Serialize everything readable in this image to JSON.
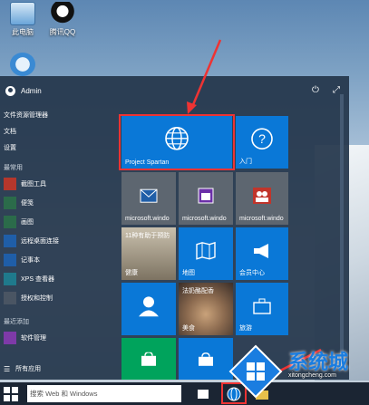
{
  "desktop": {
    "icons": [
      {
        "label": "此电脑"
      },
      {
        "label": "腾讯QQ"
      }
    ]
  },
  "start_menu": {
    "user": "Admin",
    "links": [
      "文件资源管理器",
      "文档",
      "设置"
    ],
    "section_frequent": "最常用",
    "apps": [
      "截图工具",
      "便笺",
      "画图",
      "远程桌面连接",
      "记事本",
      "XPS 查看器",
      "授权和控制"
    ],
    "section_recent": "最近添加",
    "recent_apps": [
      "软件管理"
    ],
    "all_apps": "所有应用"
  },
  "tiles": {
    "spartan": "Project Spartan",
    "getstarted": "入门",
    "mail": "microsoft.windo",
    "calendar": "microsoft.windo",
    "people": "microsoft.windo",
    "health_top": "11种有助于预防",
    "health_bottom": "健康",
    "maps": "地图",
    "contact": "会员中心",
    "user_tile": "",
    "food_top": "法奶酪配香",
    "food_bottom": "美食",
    "travel": "旅游"
  },
  "taskbar": {
    "search_placeholder": "搜索 Web 和 Windows"
  },
  "watermark": {
    "brand": "系统城",
    "url": "xitongcheng.com"
  },
  "colors": {
    "tile_blue": "#0a78d7",
    "tile_gray": "#5d6670",
    "tile_teal": "#0a78d7",
    "tile_green": "#00a35c",
    "tile_red": "#c1352b",
    "highlight": "#ee3333"
  }
}
